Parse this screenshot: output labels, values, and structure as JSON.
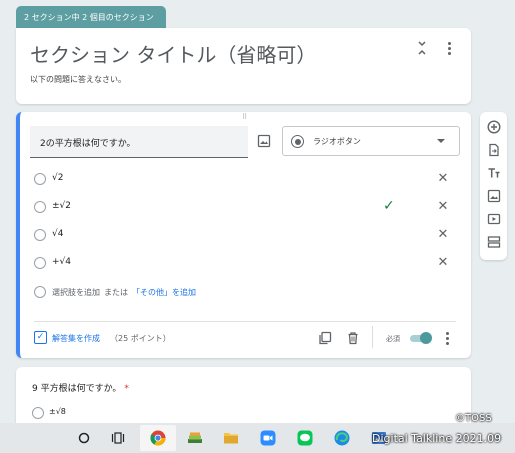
{
  "section": {
    "tab_label": "2 セクション中 2 個目のセクション",
    "title": "セクション タイトル（省略可）",
    "description": "以下の問題に答えなさい。"
  },
  "question1": {
    "text": "2の平方根は何ですか。",
    "type_label": "ラジオボタン",
    "options": [
      {
        "label": "√2",
        "correct": false
      },
      {
        "label": "±√2",
        "correct": true
      },
      {
        "label": "√4",
        "correct": false
      },
      {
        "label": "+√4",
        "correct": false
      }
    ],
    "add_option": "選択肢を追加",
    "or_text": "または",
    "add_other": "「その他」を追加",
    "answer_key": "解答集を作成",
    "points": "（25 ポイント）",
    "required_label": "必須",
    "required": true
  },
  "question2": {
    "text": "9 平方根は何ですか。",
    "required_mark": "*",
    "first_option": "±√8"
  },
  "sidebar_tools": [
    "add-question-icon",
    "import-questions-icon",
    "add-title-icon",
    "add-image-icon",
    "add-video-icon",
    "add-section-icon"
  ],
  "taskbar_items": [
    "search-icon",
    "task-view-icon",
    "chrome-icon",
    "stack-app-icon",
    "file-explorer-icon",
    "zoom-icon",
    "line-icon",
    "edge-icon",
    "image-app-icon"
  ],
  "watermark": {
    "copyright": "©TOSS",
    "credit": "Digital Talkline 2021.09"
  },
  "colors": {
    "accent_teal": "#5d9ea3",
    "accent_blue": "#4285f4",
    "link_blue": "#1a73e8",
    "check_green": "#188038",
    "required_red": "#d93025"
  }
}
